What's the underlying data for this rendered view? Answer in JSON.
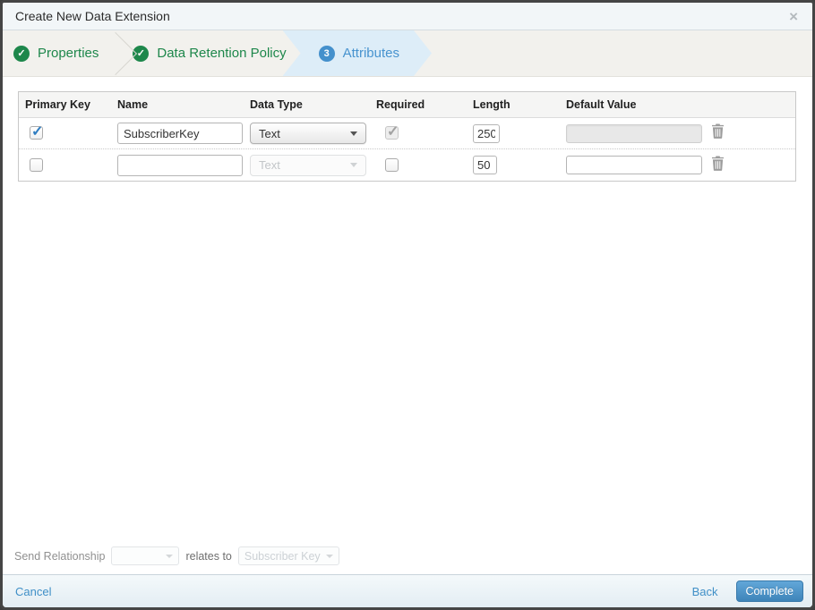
{
  "modal": {
    "title": "Create New Data Extension",
    "close_icon": "×"
  },
  "wizard": {
    "steps": [
      {
        "label": "Properties",
        "state": "complete",
        "icon": "check-circle"
      },
      {
        "label": "Data Retention Policy",
        "state": "complete",
        "icon": "check-circle"
      },
      {
        "label": "Attributes",
        "state": "active",
        "number": "3"
      }
    ]
  },
  "attributes_table": {
    "headers": [
      "Primary Key",
      "Name",
      "Data Type",
      "Required",
      "Length",
      "Default Value"
    ],
    "rows": [
      {
        "primary_key_checked": true,
        "name": "SubscriberKey",
        "data_type": "Text",
        "required_checked": true,
        "required_disabled": true,
        "length": "250",
        "default_value": "",
        "default_value_disabled": true
      },
      {
        "primary_key_checked": false,
        "name": "",
        "data_type": "Text",
        "data_type_disabled": true,
        "required_checked": false,
        "length": "50",
        "default_value": "",
        "default_value_disabled": false
      }
    ]
  },
  "send_relationship": {
    "label": "Send Relationship",
    "field_value": "",
    "relates_to_label": "relates to",
    "target_value": "Subscriber Key"
  },
  "footer": {
    "cancel_label": "Cancel",
    "back_label": "Back",
    "complete_label": "Complete"
  },
  "colors": {
    "step_complete_green": "#1e874b",
    "step_active_blue": "#4793cf",
    "step_active_bg": "#ddedf8",
    "checkbox_check_blue": "#2f7dc1",
    "link_blue": "#3f8fc7",
    "complete_button_top": "#62a7d9",
    "complete_button_bottom": "#3e84b9"
  }
}
